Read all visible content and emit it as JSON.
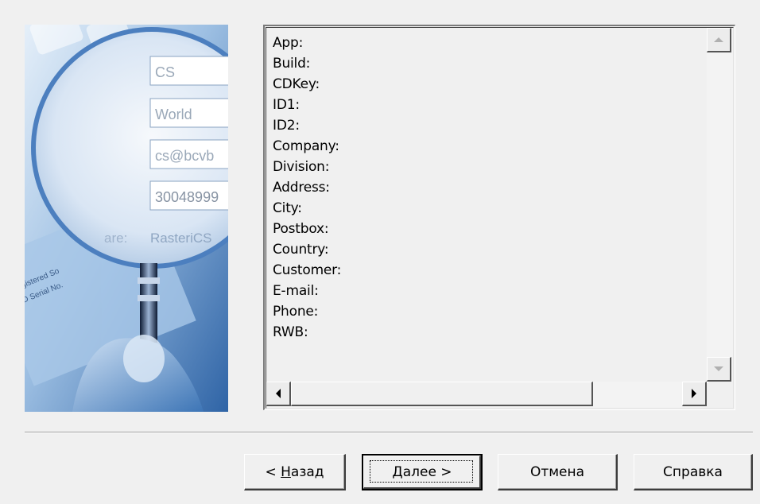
{
  "illustration": {
    "field_values": [
      "CS",
      "World",
      "cs@bcvb",
      "30048999"
    ],
    "software_label": "are:",
    "software_value": "RasteriCS",
    "card_text_1": "Registered So",
    "card_text_2": "CD Serial No."
  },
  "info_list": {
    "lines": [
      "App:",
      "Build:",
      "CDKey:",
      "ID1:",
      "ID2:",
      "Company:",
      "Division:",
      "Address:",
      "City:",
      "Postbox:",
      "Country:",
      "Customer:",
      "E-mail:",
      "Phone:",
      "RWB:"
    ]
  },
  "buttons": {
    "back_prefix": "< ",
    "back_mnemonic": "Н",
    "back_rest": "азад",
    "next_mnemonic": "Д",
    "next_rest": "алее >",
    "cancel": "Отмена",
    "help": "Справка"
  }
}
